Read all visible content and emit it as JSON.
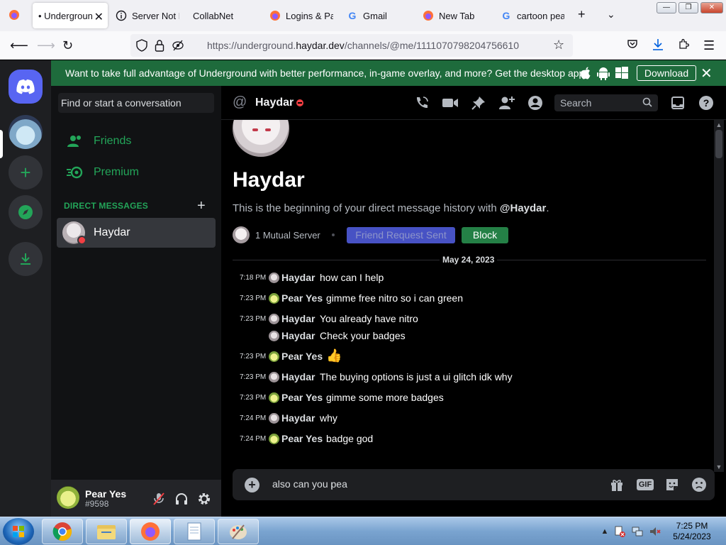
{
  "browser": {
    "tabs": [
      {
        "label": "• Undergroun",
        "active": true
      },
      {
        "label": "Server Not F"
      },
      {
        "label": "CollabNet"
      },
      {
        "label": "Logins & Pa"
      },
      {
        "label": "Gmail"
      },
      {
        "label": "New Tab"
      },
      {
        "label": "cartoon pea"
      }
    ],
    "url_prefix": "https://underground.",
    "url_domain": "haydar.dev",
    "url_path": "/channels/@me/1111070798204756610"
  },
  "notice": {
    "text": "Want to take full advantage of Underground with better performance, in-game overlay, and more? Get the desktop app!",
    "download_label": "Download"
  },
  "sidebar": {
    "search_placeholder": "Find or start a conversation",
    "friends_label": "Friends",
    "premium_label": "Premium",
    "dm_header": "DIRECT MESSAGES",
    "dm_plus": "+",
    "dm_items": [
      {
        "name": "Haydar"
      }
    ]
  },
  "user_panel": {
    "name": "Pear Yes",
    "tag": "#9598"
  },
  "header": {
    "at": "@",
    "channel_name": "Haydar",
    "search_placeholder": "Search"
  },
  "intro": {
    "name": "Haydar",
    "text_prefix": "This is the beginning of your direct message history with ",
    "mention": "@Haydar",
    "text_suffix": ".",
    "mutual": "1 Mutual Server",
    "friend_request": "Friend Request Sent",
    "block": "Block",
    "date": "May 24, 2023"
  },
  "messages": [
    {
      "time": "7:18 PM",
      "author": "Haydar",
      "text": "how can I help",
      "avatar": "h"
    },
    {
      "time": "7:23 PM",
      "author": "Pear Yes",
      "text": "gimme free nitro so i can green",
      "avatar": "p"
    },
    {
      "time": "7:23 PM",
      "author": "Haydar",
      "text": "You already have nitro",
      "avatar": "h"
    },
    {
      "time": "",
      "author": "Haydar",
      "text": "Check your badges",
      "avatar": "h"
    },
    {
      "time": "7:23 PM",
      "author": "Pear Yes",
      "text": "👍",
      "avatar": "p"
    },
    {
      "time": "7:23 PM",
      "author": "Haydar",
      "text": "The buying options is just a ui glitch idk why",
      "avatar": "h"
    },
    {
      "time": "7:23 PM",
      "author": "Pear Yes",
      "text": "gimme some more badges",
      "avatar": "p"
    },
    {
      "time": "7:24 PM",
      "author": "Haydar",
      "text": "why",
      "avatar": "h"
    },
    {
      "time": "7:24 PM",
      "author": "Pear Yes",
      "text": "badge god",
      "avatar": "p"
    }
  ],
  "composer": {
    "value": "also can you pea",
    "gif_label": "GIF"
  },
  "taskbar": {
    "time": "7:25 PM",
    "date": "5/24/2023"
  },
  "colors": {
    "blurple": "#5865f2",
    "banner_green": "#1e6b3c",
    "block_green": "#248046",
    "dnd_red": "#f23f43"
  }
}
